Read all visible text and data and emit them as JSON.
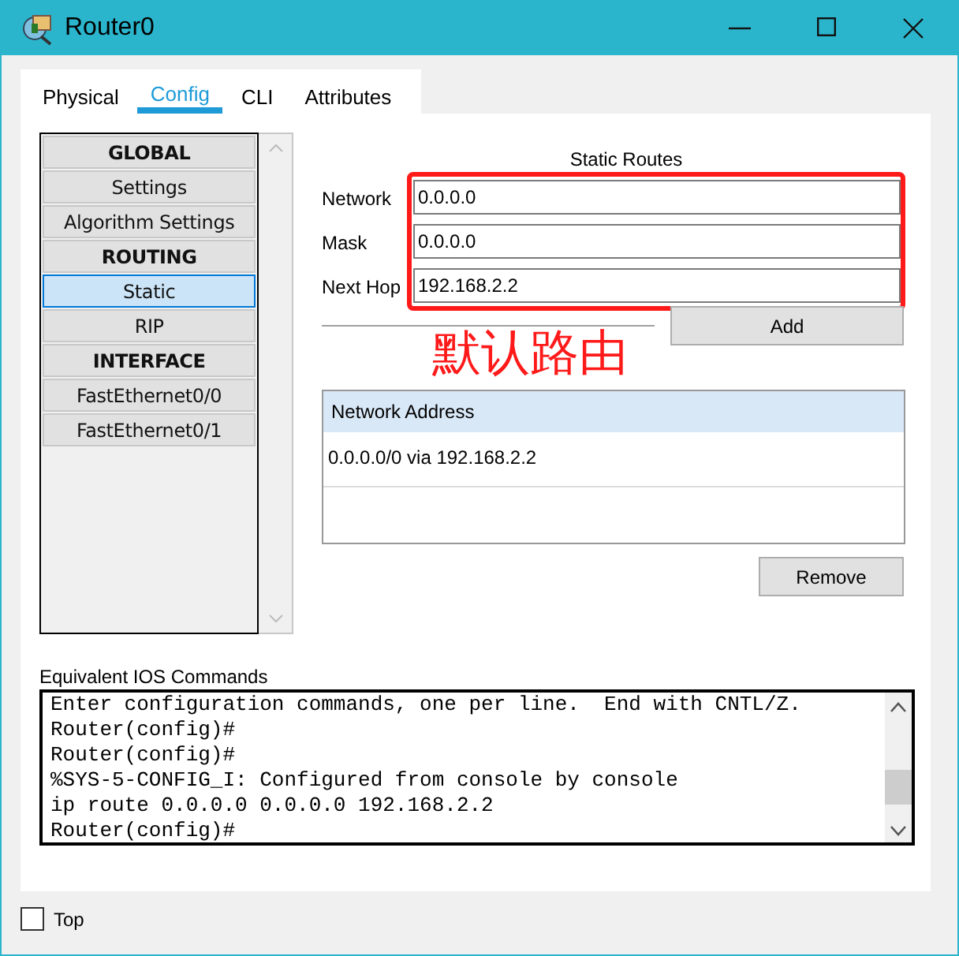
{
  "window": {
    "title": "Router0"
  },
  "tabs": [
    {
      "label": "Physical",
      "selected": false
    },
    {
      "label": "Config",
      "selected": true
    },
    {
      "label": "CLI",
      "selected": false
    },
    {
      "label": "Attributes",
      "selected": false
    }
  ],
  "nav": {
    "items": [
      {
        "label": "GLOBAL",
        "kind": "header",
        "selected": false
      },
      {
        "label": "Settings",
        "kind": "item",
        "selected": false
      },
      {
        "label": "Algorithm Settings",
        "kind": "item",
        "selected": false
      },
      {
        "label": "ROUTING",
        "kind": "header",
        "selected": false
      },
      {
        "label": "Static",
        "kind": "item",
        "selected": true
      },
      {
        "label": "RIP",
        "kind": "item",
        "selected": false
      },
      {
        "label": "INTERFACE",
        "kind": "header",
        "selected": false
      },
      {
        "label": "FastEthernet0/0",
        "kind": "item",
        "selected": false
      },
      {
        "label": "FastEthernet0/1",
        "kind": "item",
        "selected": false
      }
    ]
  },
  "static_routes": {
    "title": "Static Routes",
    "fields": [
      {
        "label": "Network",
        "value": "0.0.0.0"
      },
      {
        "label": "Mask",
        "value": "0.0.0.0"
      },
      {
        "label": "Next Hop",
        "value": "192.168.2.2"
      }
    ],
    "add_button": "Add",
    "annotation": "默认路由",
    "table": {
      "column": "Network Address",
      "rows": [
        "0.0.0.0/0 via 192.168.2.2"
      ]
    },
    "remove_button": "Remove"
  },
  "console": {
    "title": "Equivalent IOS Commands",
    "lines": [
      "Enter configuration commands, one per line.  End with CNTL/Z.",
      "Router(config)#",
      "Router(config)#",
      "%SYS-5-CONFIG_I: Configured from console by console",
      "ip route 0.0.0.0 0.0.0.0 192.168.2.2",
      "Router(config)#"
    ]
  },
  "top_checkbox": {
    "label": "Top",
    "checked": false
  }
}
